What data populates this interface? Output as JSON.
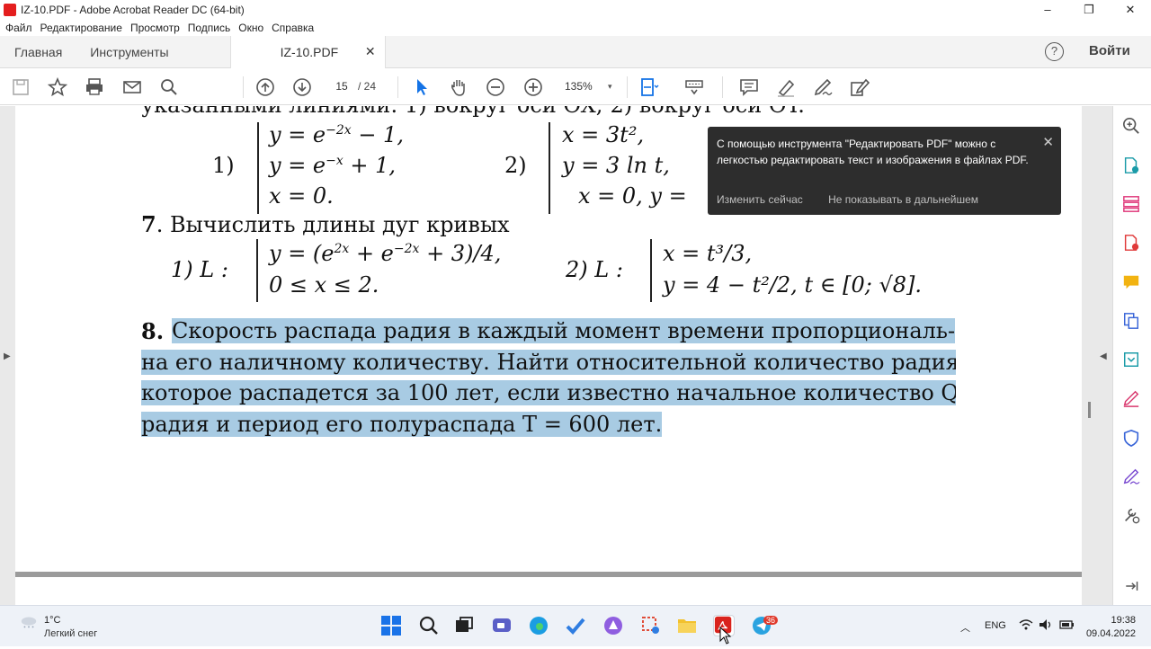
{
  "window": {
    "title": "IZ-10.PDF - Adobe Acrobat Reader DC (64-bit)",
    "minimize": "–",
    "maximize": "❐",
    "close": "✕"
  },
  "menu": [
    "Файл",
    "Редактирование",
    "Просмотр",
    "Подпись",
    "Окно",
    "Справка"
  ],
  "tabs": {
    "home": "Главная",
    "tools": "Инструменты",
    "doc": "IZ-10.PDF",
    "doc_close": "✕"
  },
  "header": {
    "help": "?",
    "signin": "Войти"
  },
  "toolbar": {
    "page_current": "15",
    "page_total": "/ 24",
    "zoom": "135%",
    "zoom_caret": "▾"
  },
  "document": {
    "line_top": "указанными линиями: 1)    вокруг оси OX;        2)   вокруг оси OY.",
    "p1_num": "1)",
    "p1_l1": "y = e",
    "p1_l1_exp": "−2x",
    "p1_l1_tail": " − 1,",
    "p1_l2": "y = e",
    "p1_l2_exp": "−x",
    "p1_l2_tail": " + 1,",
    "p1_l3": "x = 0.",
    "p2_num": "2)",
    "p2_l1": "x = 3t²,",
    "p2_l2": "y = 3 ln t,",
    "p2_l3": "x = 0,    y =",
    "task7_num": "7",
    "task7_text": ". Вычислить длины дуг кривых",
    "t7_1_label": "1)   L :",
    "t7_1_l1": "y = (e",
    "t7_1_l1_e1": "2x",
    "t7_1_l1_mid": " + e",
    "t7_1_l1_e2": "−2x",
    "t7_1_l1_tail": " + 3)/4,",
    "t7_1_l2": "0 ≤ x ≤ 2.",
    "t7_2_label": "2)   L :",
    "t7_2_l1": "x = t³/3,",
    "t7_2_l2": "y = 4 − t²/2,   t ∈ [0;  √8].",
    "task8_num": "8.",
    "task8_l1": "Скорость распада радия в каждый момент времени пропорциональ-",
    "task8_l2": "на его наличному количеству. Найти относительной количество радия,",
    "task8_l3": "которое распадется за 100 лет, если известно начальное количество Q₀",
    "task8_l4": "радия и период его полураспада T = 600 лет."
  },
  "toast": {
    "text": "С помощью инструмента \"Редактировать PDF\" можно с легкостью редактировать текст и изображения в файлах PDF.",
    "close": "✕",
    "action_now": "Изменить сейчас",
    "action_never": "Не показывать в дальнейшем"
  },
  "taskbar": {
    "temp": "1°C",
    "weather": "Легкий снег",
    "lang": "ENG",
    "time": "19:38",
    "date": "09.04.2022",
    "badge": "36",
    "tray_chevron": "︿"
  },
  "colors": {
    "highlight": "#a8cbe3",
    "toast_bg": "#2d2d2d",
    "accent": "#1473e6",
    "acrobat_red": "#e41e1e"
  }
}
